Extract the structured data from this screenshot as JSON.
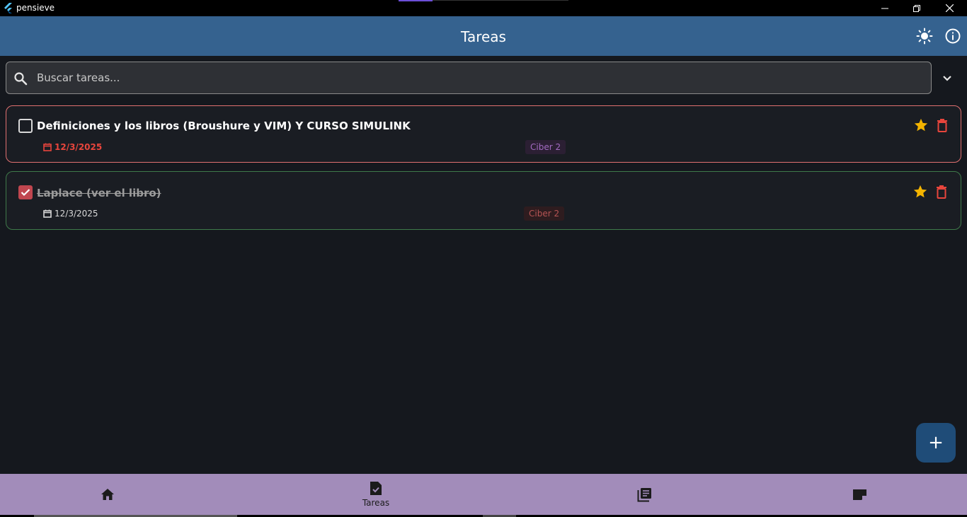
{
  "window": {
    "title": "pensieve"
  },
  "appbar": {
    "title": "Tareas"
  },
  "search": {
    "placeholder": "Buscar tareas..."
  },
  "tasks": [
    {
      "title": "Definiciones y los libros (Broushure y VIM) Y CURSO SIMULINK",
      "date": "12/3/2025",
      "tag": "Ciber 2",
      "completed": false,
      "starred": true
    },
    {
      "title": "Laplace (ver el libro)",
      "date": "12/3/2025",
      "tag": "Ciber 2",
      "completed": true,
      "starred": true
    }
  ],
  "nav": {
    "items": [
      {
        "icon": "home-icon",
        "label": ""
      },
      {
        "icon": "task-icon",
        "label": "Tareas"
      },
      {
        "icon": "library-icon",
        "label": ""
      },
      {
        "icon": "note-icon",
        "label": ""
      }
    ]
  },
  "colors": {
    "appbar": "#35628f",
    "nav": "#a28cba",
    "fab": "#1f4c78",
    "star": "#f4b400",
    "danger": "#e8453c",
    "background": "#15181e"
  }
}
